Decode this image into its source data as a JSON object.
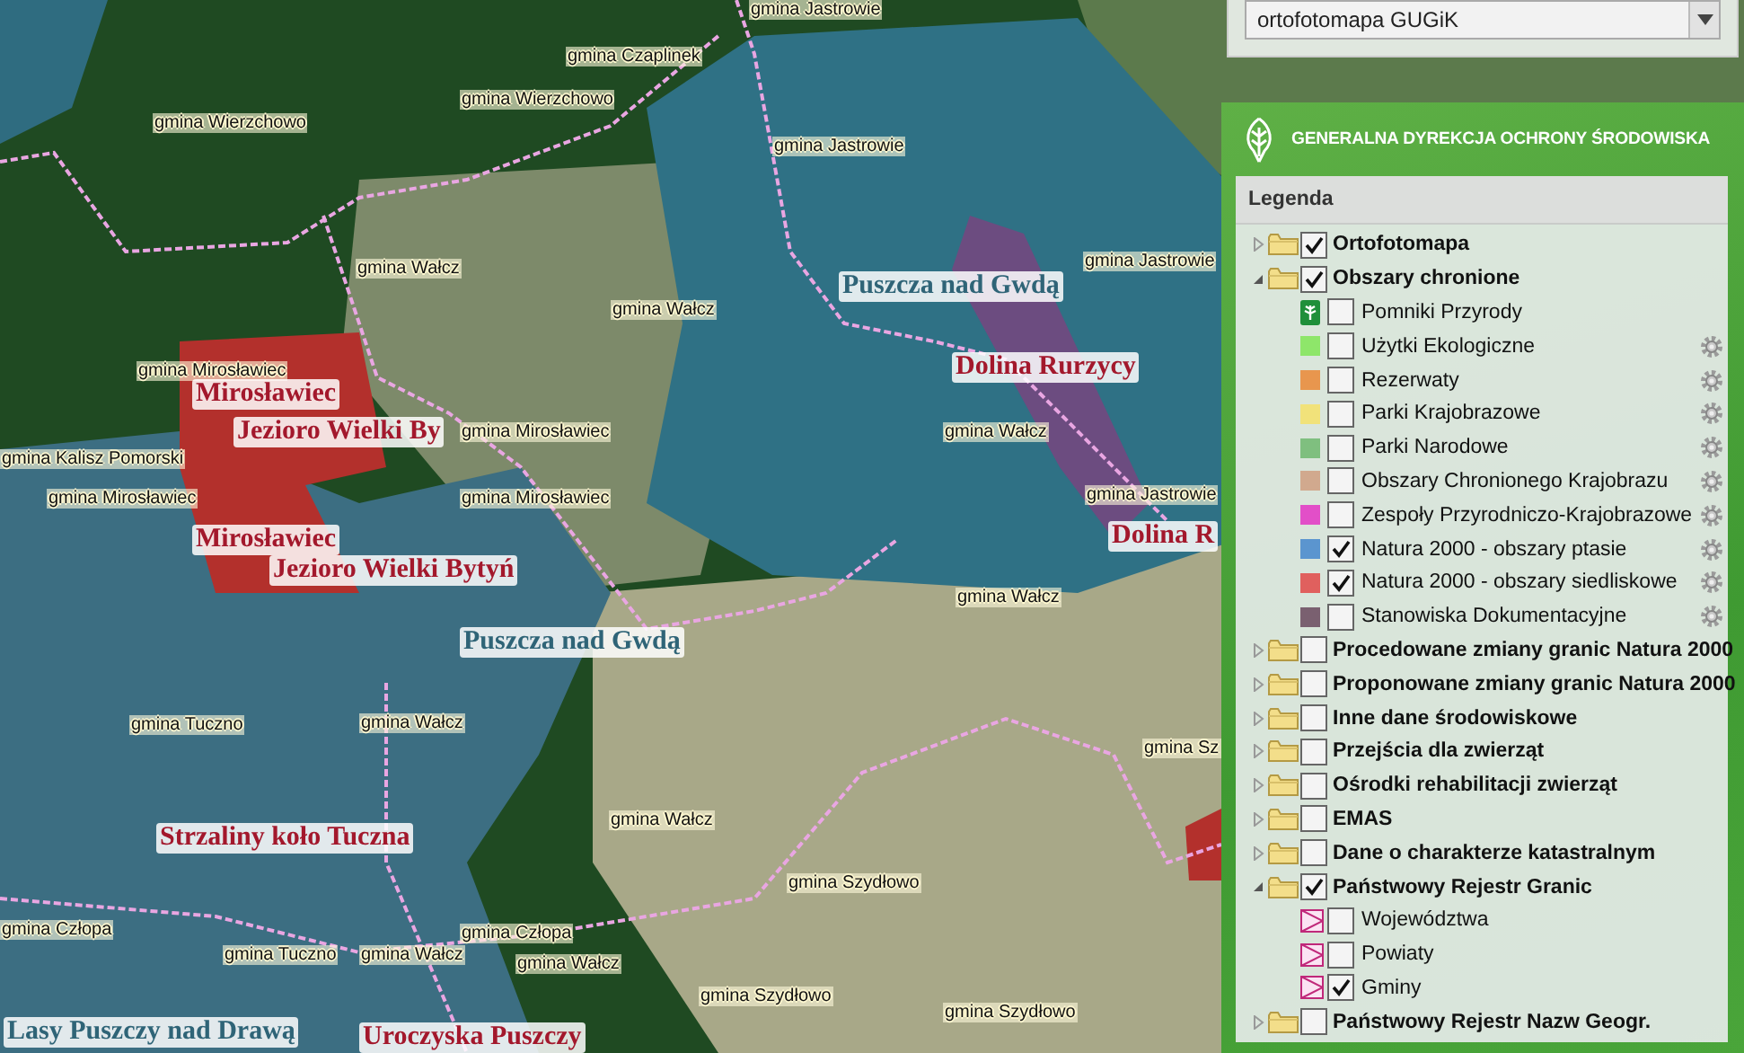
{
  "map": {
    "labels": [
      {
        "text": "gmina Jastrowie",
        "kind": "municipality"
      },
      {
        "text": "gmina Czaplinek",
        "kind": "municipality"
      },
      {
        "text": "gmina Wierzchowo",
        "kind": "municipality"
      },
      {
        "text": "gmina Wierzchowo",
        "kind": "municipality"
      },
      {
        "text": "gmina Jastrowie",
        "kind": "municipality"
      },
      {
        "text": "gmina Jastrowie",
        "kind": "municipality"
      },
      {
        "text": "gmina Wałcz",
        "kind": "municipality"
      },
      {
        "text": "Puszcza nad Gwdą",
        "kind": "bird_area"
      },
      {
        "text": "gmina Wałcz",
        "kind": "municipality"
      },
      {
        "text": "gmina Mirosławiec",
        "kind": "municipality"
      },
      {
        "text": "Dolina Rurzycy",
        "kind": "habitat_area"
      },
      {
        "text": "Mirosławiec",
        "kind": "habitat_area"
      },
      {
        "text": "Jezioro Wielki By",
        "kind": "habitat_area"
      },
      {
        "text": "gmina Mirosławiec",
        "kind": "municipality"
      },
      {
        "text": "gmina Wałcz",
        "kind": "municipality"
      },
      {
        "text": "gmina Kalisz Pomorski",
        "kind": "municipality"
      },
      {
        "text": "gmina Mirosławiec",
        "kind": "municipality"
      },
      {
        "text": "gmina Mirosławiec",
        "kind": "municipality"
      },
      {
        "text": "gmina Jastrowie",
        "kind": "municipality"
      },
      {
        "text": "Mirosławiec",
        "kind": "habitat_area"
      },
      {
        "text": "Dolina R",
        "kind": "habitat_area"
      },
      {
        "text": "Jezioro Wielki Bytyń",
        "kind": "habitat_area"
      },
      {
        "text": "gmina Wałcz",
        "kind": "municipality"
      },
      {
        "text": "Puszcza nad Gwdą",
        "kind": "bird_area"
      },
      {
        "text": "gmina Tuczno",
        "kind": "municipality"
      },
      {
        "text": "gmina Wałcz",
        "kind": "municipality"
      },
      {
        "text": "gmina Sz",
        "kind": "municipality"
      },
      {
        "text": "Strzaliny koło Tuczna",
        "kind": "habitat_area"
      },
      {
        "text": "gmina Wałcz",
        "kind": "municipality"
      },
      {
        "text": "gmina Szydłowo",
        "kind": "municipality"
      },
      {
        "text": "gmina Człopa",
        "kind": "municipality"
      },
      {
        "text": "gmina Człopa",
        "kind": "municipality"
      },
      {
        "text": "gmina Tuczno",
        "kind": "municipality"
      },
      {
        "text": "gmina Wałcz",
        "kind": "municipality"
      },
      {
        "text": "gmina Wałcz",
        "kind": "municipality"
      },
      {
        "text": "gmina Szydłowo",
        "kind": "municipality"
      },
      {
        "text": "gmina Szydłowo",
        "kind": "municipality"
      },
      {
        "text": "Lasy Puszczy nad Drawą",
        "kind": "bird_area"
      },
      {
        "text": "Uroczyska Puszczy",
        "kind": "habitat_area"
      }
    ]
  },
  "basemap_select": {
    "value": "ortofotomapa GUGiK"
  },
  "panel": {
    "title": "GENERALNA DYREKCJA OCHRONY ŚRODOWISKA"
  },
  "legend": {
    "title": "Legenda",
    "items": [
      {
        "label": "Ortofotomapa",
        "checked": true,
        "expanded": false
      },
      {
        "label": "Obszary chronione",
        "checked": true,
        "expanded": true,
        "children": [
          {
            "label": "Pomniki Przyrody",
            "kind": "emblem",
            "checked": false,
            "settings": false
          },
          {
            "label": "Użytki Ekologiczne",
            "kind": "swatch",
            "color": "#8ee66a",
            "checked": false,
            "settings": true
          },
          {
            "label": "Rezerwaty",
            "kind": "swatch",
            "color": "#e8964e",
            "checked": false,
            "settings": true
          },
          {
            "label": "Parki Krajobrazowe",
            "kind": "swatch",
            "color": "#f1e27a",
            "checked": false,
            "settings": true
          },
          {
            "label": "Parki Narodowe",
            "kind": "swatch",
            "color": "#7fbf7f",
            "checked": false,
            "settings": true
          },
          {
            "label": "Obszary Chronionego Krajobrazu",
            "kind": "swatch",
            "color": "#d1a98e",
            "checked": false,
            "settings": true
          },
          {
            "label": "Zespoły Przyrodniczo-Krajobrazowe",
            "kind": "swatch",
            "color": "#e24fc8",
            "checked": false,
            "settings": true
          },
          {
            "label": "Natura 2000 - obszary ptasie",
            "kind": "swatch",
            "color": "#5b95cf",
            "checked": true,
            "settings": true
          },
          {
            "label": "Natura 2000 - obszary siedliskowe",
            "kind": "swatch",
            "color": "#e0605e",
            "checked": true,
            "settings": true
          },
          {
            "label": "Stanowiska Dokumentacyjne",
            "kind": "swatch",
            "color": "#7a6070",
            "checked": false,
            "settings": true
          }
        ]
      },
      {
        "label": "Procedowane zmiany granic Natura 2000",
        "checked": false,
        "expanded": false
      },
      {
        "label": "Proponowane zmiany granic Natura 2000",
        "checked": false,
        "expanded": false
      },
      {
        "label": "Inne dane środowiskowe",
        "checked": false,
        "expanded": false
      },
      {
        "label": "Przejścia dla zwierząt",
        "checked": false,
        "expanded": false
      },
      {
        "label": "Ośrodki rehabilitacji zwierząt",
        "checked": false,
        "expanded": false
      },
      {
        "label": "EMAS",
        "checked": false,
        "expanded": false
      },
      {
        "label": "Dane o charakterze katastralnym",
        "checked": false,
        "expanded": false
      },
      {
        "label": "Państwowy Rejestr Granic",
        "checked": true,
        "expanded": true,
        "children": [
          {
            "label": "Województwa",
            "kind": "boundary",
            "checked": false,
            "settings": false
          },
          {
            "label": "Powiaty",
            "kind": "boundary",
            "checked": false,
            "settings": false
          },
          {
            "label": "Gminy",
            "kind": "boundary",
            "checked": true,
            "settings": false
          }
        ]
      },
      {
        "label": "Państwowy Rejestr Nazw Geogr.",
        "checked": false,
        "expanded": false
      }
    ]
  }
}
